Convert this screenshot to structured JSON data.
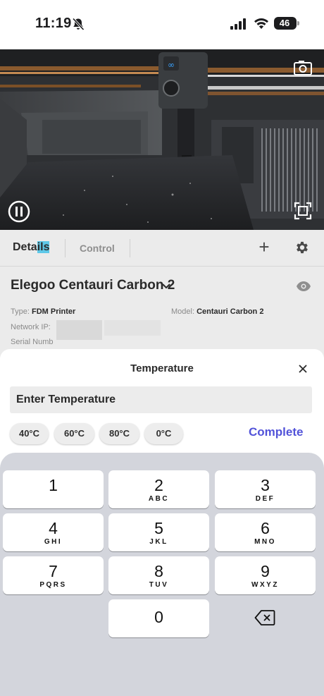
{
  "status_bar": {
    "time": "11:19",
    "battery": "46",
    "icons": [
      "bell-slash-icon",
      "cellular-signal-icon",
      "wifi-icon",
      "battery-icon"
    ]
  },
  "camera": {
    "icons": [
      "snapshot-camera-icon",
      "pause-icon",
      "fullscreen-icon"
    ],
    "nozzle_logo": "∞"
  },
  "tabs": {
    "details_pre": "Deta",
    "details_hl": "ils",
    "control": "Control",
    "plus": "+",
    "icons": [
      "plus-icon",
      "gear-icon"
    ]
  },
  "printer": {
    "name": "Elegoo Centauri Carbon 2",
    "type_label": "Type:",
    "type_value": "FDM Printer",
    "model_label": "Model:",
    "model_value": "Centauri Carbon 2",
    "network_label": "Network IP:",
    "serial_label": "Serial Numb"
  },
  "sheet": {
    "title": "Temperature",
    "input_placeholder": "Enter Temperature",
    "input_value": "",
    "chips": [
      "40°C",
      "60°C",
      "80°C",
      "0°C"
    ],
    "complete_label": "Complete",
    "accent_color": "#5253d9"
  },
  "keyboard": {
    "keys": [
      {
        "digit": "1",
        "letters": ""
      },
      {
        "digit": "2",
        "letters": "ABC"
      },
      {
        "digit": "3",
        "letters": "DEF"
      },
      {
        "digit": "4",
        "letters": "GHI"
      },
      {
        "digit": "5",
        "letters": "JKL"
      },
      {
        "digit": "6",
        "letters": "MNO"
      },
      {
        "digit": "7",
        "letters": "PQRS"
      },
      {
        "digit": "8",
        "letters": "TUV"
      },
      {
        "digit": "9",
        "letters": "WXYZ"
      },
      {
        "digit": "0",
        "letters": ""
      }
    ],
    "backspace_icon": "backspace-icon"
  }
}
